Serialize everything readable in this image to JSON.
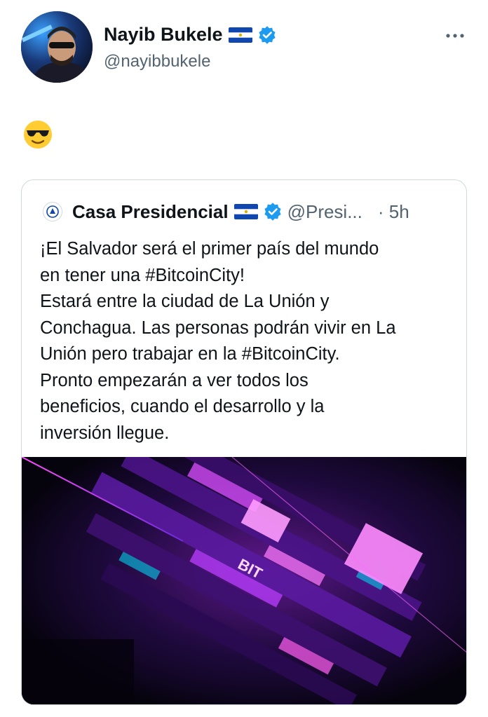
{
  "tweet": {
    "author": {
      "name": "Nayib Bukele",
      "handle": "@nayibbukele"
    },
    "body_emoji": "😎",
    "more_icon": "more-horizontal-icon"
  },
  "quote": {
    "author": {
      "name": "Casa Presidencial",
      "handle": "@Presi...",
      "time": "· 5h"
    },
    "text_lines": [
      "¡El Salvador será el primer país del mundo",
      "en tener una #BitcoinCity!",
      "Estará entre la ciudad de La Unión y",
      "Conchagua. Las personas podrán vivir en La",
      "Unión pero trabajar en la #BitcoinCity.",
      "Pronto empezarán a ver todos los",
      "beneficios, cuando el desarrollo y la",
      "inversión llegue."
    ],
    "media_sign_text": "BIT"
  },
  "colors": {
    "verified": "#1d9bf0",
    "flag_blue": "#0f47af",
    "secondary_text": "#536471",
    "accent_pink": "#e040fb"
  }
}
